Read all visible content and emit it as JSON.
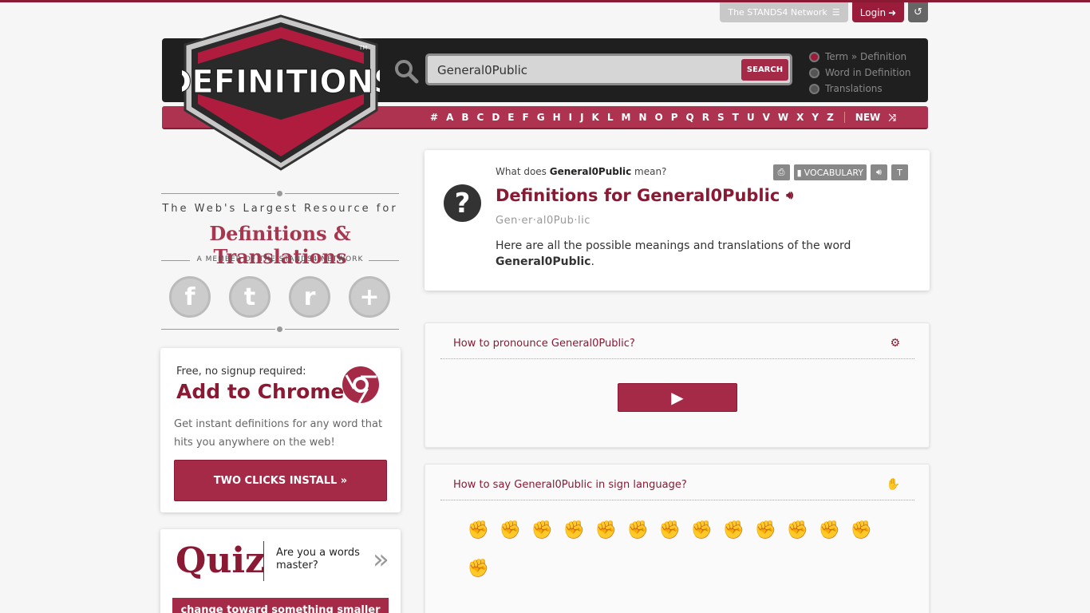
{
  "topbar": {
    "network_label": "The STANDS4 Network",
    "network_icon": "menu-icon",
    "login_label": "Login",
    "login_icon": "login-arrow-icon",
    "history_icon": "history-icon"
  },
  "logo": {
    "text": "DEFINITIONS",
    "trademark": "TM"
  },
  "search": {
    "value": "General0Public",
    "button_label": "SEARCH",
    "modes": [
      {
        "label": "Term » Definition",
        "checked": true
      },
      {
        "label": "Word in Definition",
        "checked": false
      },
      {
        "label": "Translations",
        "checked": false
      }
    ]
  },
  "alphabet": [
    "#",
    "A",
    "B",
    "C",
    "D",
    "E",
    "F",
    "G",
    "H",
    "I",
    "J",
    "K",
    "L",
    "M",
    "N",
    "O",
    "P",
    "Q",
    "R",
    "S",
    "T",
    "U",
    "V",
    "W",
    "X",
    "Y",
    "Z"
  ],
  "alphabet_extra": {
    "new_label": "NEW",
    "shuffle_icon": "shuffle-icon"
  },
  "sidebar": {
    "tagline1": "The Web's Largest Resource for",
    "tagline2": "Definitions & Translations",
    "tagline3": "A MEMBER OF THE STANDS4 NETWORK",
    "socials": [
      {
        "name": "facebook-icon",
        "glyph": "f"
      },
      {
        "name": "twitter-icon",
        "glyph": "t"
      },
      {
        "name": "reddit-icon",
        "glyph": "r"
      },
      {
        "name": "plus-icon",
        "glyph": "+"
      }
    ],
    "chrome": {
      "free_label": "Free, no signup required:",
      "title": "Add to Chrome",
      "description": "Get instant definitions for any word that hits you anywhere on the web!",
      "install_label": "TWO CLICKS INSTALL »"
    },
    "quiz": {
      "title": "Quiz",
      "subtitle": "Are you a words master?",
      "arrow": "»",
      "question": "change toward something smaller"
    }
  },
  "definition": {
    "question_prefix": "What does",
    "question_term": "General0Public",
    "question_suffix": "mean?",
    "title": "Definitions for General0Public",
    "syllables": "Gen·er·al0Pub·lic",
    "desc": "Here are all the possible meanings and translations of the word",
    "desc_term": "General0Public",
    "toolbar": [
      {
        "name": "print-icon",
        "label": ""
      },
      {
        "name": "vocabulary-button",
        "label": "VOCABULARY"
      },
      {
        "name": "speaker-icon",
        "label": ""
      },
      {
        "name": "font-size-icon",
        "label": ""
      }
    ]
  },
  "pronounce": {
    "title": "How to pronounce General0Public?",
    "icon": "gear-icon"
  },
  "sign": {
    "title": "How to say General0Public in sign language?",
    "icon": "sign-hands-icon"
  },
  "sign_letters": [
    "G",
    "E",
    "N",
    "E",
    "R",
    "A",
    "L",
    "O",
    "P",
    "U",
    "B",
    "L",
    "I",
    "C"
  ],
  "colors": {
    "brand": "#8a1a33",
    "accent": "#a52a47",
    "dark": "#1f1f1f"
  }
}
